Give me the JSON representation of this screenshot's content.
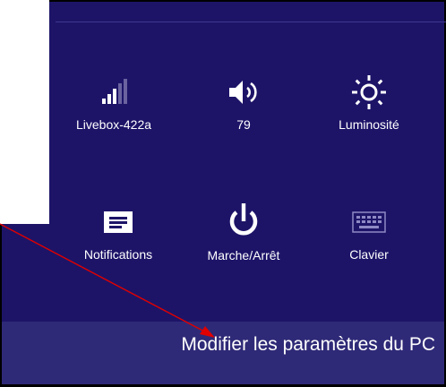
{
  "tiles": [
    {
      "name": "network",
      "label": "Livebox-422a",
      "icon": "wifi-signal-icon"
    },
    {
      "name": "volume",
      "label": "79",
      "icon": "speaker-icon"
    },
    {
      "name": "brightness",
      "label": "Luminosité",
      "icon": "sun-icon"
    },
    {
      "name": "notifications",
      "label": "Notifications",
      "icon": "message-icon"
    },
    {
      "name": "power",
      "label": "Marche/Arrêt",
      "icon": "power-icon"
    },
    {
      "name": "keyboard",
      "label": "Clavier",
      "icon": "keyboard-icon"
    }
  ],
  "bottom_bar": {
    "text": "Modifier les paramètres du PC"
  },
  "colors": {
    "panel": "#1d1468",
    "bottom_bar": "#2f2a77",
    "annotation_arrow": "#e00000"
  }
}
